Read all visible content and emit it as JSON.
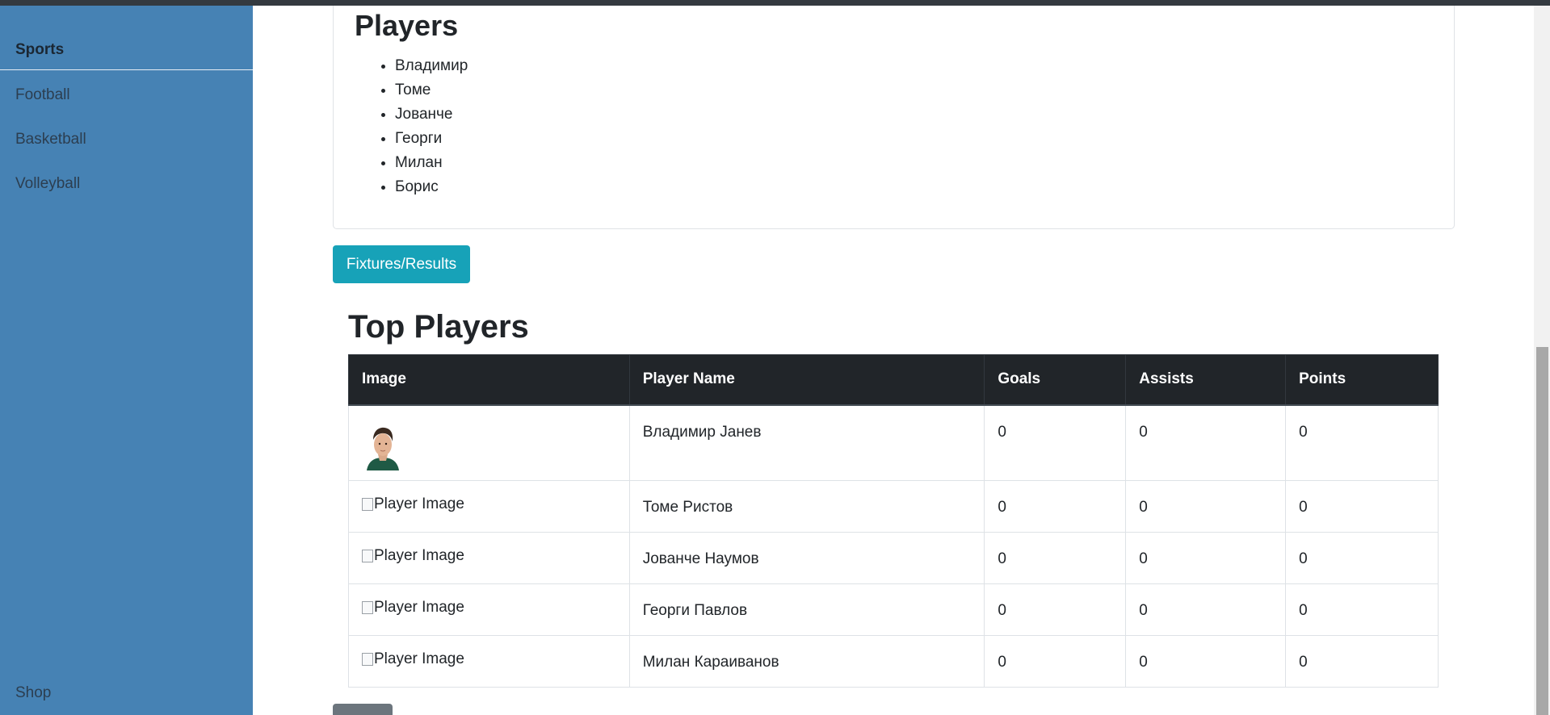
{
  "sidebar": {
    "brand": "Sports",
    "items": [
      {
        "label": "Football"
      },
      {
        "label": "Basketball"
      },
      {
        "label": "Volleyball"
      }
    ],
    "footer": "Shop"
  },
  "players_card": {
    "title": "Players",
    "players": [
      "Владимир",
      "Томе",
      "Јованче",
      "Георги",
      "Милан",
      "Борис"
    ]
  },
  "fixtures_button": "Fixtures/Results",
  "top_players": {
    "title": "Top Players",
    "headers": [
      "Image",
      "Player Name",
      "Goals",
      "Assists",
      "Points"
    ],
    "rows": [
      {
        "image": "photo",
        "name": "Владимир Јанев",
        "goals": "0",
        "assists": "0",
        "points": "0"
      },
      {
        "image": "Player Image",
        "name": "Томе Ристов",
        "goals": "0",
        "assists": "0",
        "points": "0"
      },
      {
        "image": "Player Image",
        "name": "Јованче Наумов",
        "goals": "0",
        "assists": "0",
        "points": "0"
      },
      {
        "image": "Player Image",
        "name": "Георги Павлов",
        "goals": "0",
        "assists": "0",
        "points": "0"
      },
      {
        "image": "Player Image",
        "name": "Милан Караиванов",
        "goals": "0",
        "assists": "0",
        "points": "0"
      }
    ]
  },
  "colors": {
    "sidebar": "#4682b4",
    "accent_button": "#17a2b8",
    "table_header": "#212529"
  }
}
